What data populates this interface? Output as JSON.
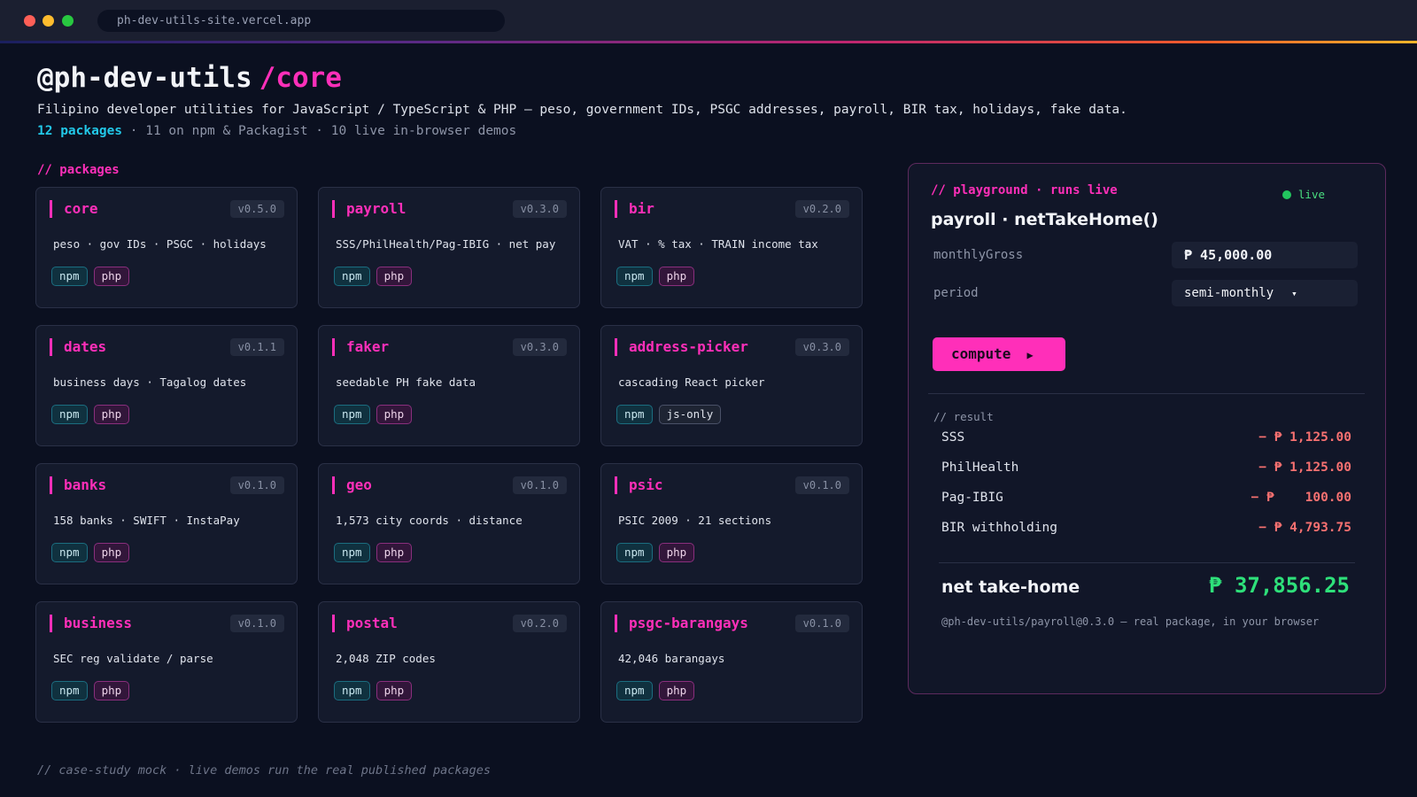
{
  "browser": {
    "url": "ph-dev-utils-site.vercel.app"
  },
  "header": {
    "title": "@ph-dev-utils",
    "title_accent": "/core",
    "subtitle": "Filipino developer utilities for JavaScript / TypeScript & PHP — peso, government IDs, PSGC addresses, payroll, BIR tax, holidays, fake data.",
    "stats_count": "12 packages",
    "stats_rest": " · 11 on npm & Packagist · 10 live in-browser demos"
  },
  "packages_label": "// packages",
  "packages": [
    {
      "name": "core",
      "version": "v0.5.0",
      "desc": "peso · gov IDs · PSGC · holidays",
      "tags": [
        "npm",
        "php"
      ]
    },
    {
      "name": "payroll",
      "version": "v0.3.0",
      "desc": "SSS/PhilHealth/Pag-IBIG · net pay",
      "tags": [
        "npm",
        "php"
      ]
    },
    {
      "name": "bir",
      "version": "v0.2.0",
      "desc": "VAT · % tax · TRAIN income tax",
      "tags": [
        "npm",
        "php"
      ]
    },
    {
      "name": "dates",
      "version": "v0.1.1",
      "desc": "business days · Tagalog dates",
      "tags": [
        "npm",
        "php"
      ]
    },
    {
      "name": "faker",
      "version": "v0.3.0",
      "desc": "seedable PH fake data",
      "tags": [
        "npm",
        "php"
      ]
    },
    {
      "name": "address-picker",
      "version": "v0.3.0",
      "desc": "cascading React picker",
      "tags": [
        "npm",
        "js-only"
      ]
    },
    {
      "name": "banks",
      "version": "v0.1.0",
      "desc": "158 banks · SWIFT · InstaPay",
      "tags": [
        "npm",
        "php"
      ]
    },
    {
      "name": "geo",
      "version": "v0.1.0",
      "desc": "1,573 city coords · distance",
      "tags": [
        "npm",
        "php"
      ]
    },
    {
      "name": "psic",
      "version": "v0.1.0",
      "desc": "PSIC 2009 · 21 sections",
      "tags": [
        "npm",
        "php"
      ]
    },
    {
      "name": "business",
      "version": "v0.1.0",
      "desc": "SEC reg validate / parse",
      "tags": [
        "npm",
        "php"
      ]
    },
    {
      "name": "postal",
      "version": "v0.2.0",
      "desc": "2,048 ZIP codes",
      "tags": [
        "npm",
        "php"
      ]
    },
    {
      "name": "psgc-barangays",
      "version": "v0.1.0",
      "desc": "42,046 barangays",
      "tags": [
        "npm",
        "php"
      ]
    }
  ],
  "playground": {
    "label": "// playground · runs live",
    "live": "live",
    "title": "payroll · netTakeHome()",
    "fields": {
      "gross_label": "monthlyGross",
      "gross_value": "₱ 45,000.00",
      "period_label": "period",
      "period_value": "semi-monthly",
      "period_arrow": "▾"
    },
    "compute_label": "compute",
    "compute_icon": "▶",
    "result_label": "// result",
    "results": [
      {
        "label": "SSS",
        "value": "− ₱ 1,125.00"
      },
      {
        "label": "PhilHealth",
        "value": "− ₱ 1,125.00"
      },
      {
        "label": "Pag-IBIG",
        "value": "− ₱    100.00"
      },
      {
        "label": "BIR withholding",
        "value": "− ₱ 4,793.75"
      }
    ],
    "net_label": "net take-home",
    "net_value": "₱ 37,856.25",
    "footnote": "@ph-dev-utils/payroll@0.3.0 — real package, in your browser"
  },
  "footer": "// case-study mock · live demos run the real published packages",
  "colors": {
    "accent": "#ff2fb9",
    "cyan": "#22c8e8",
    "negative": "#f87171",
    "positive": "#2ee07a"
  }
}
